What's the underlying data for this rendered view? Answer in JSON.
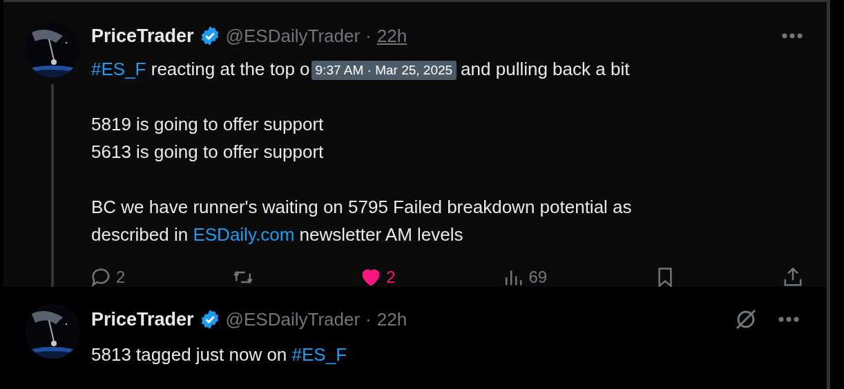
{
  "tweets": [
    {
      "author": "PriceTrader",
      "verified": true,
      "handle": "@ESDailyTrader",
      "separator": "·",
      "time": "22h",
      "time_hovered": true,
      "expanded": true,
      "paragraphs": [
        [
          [
            {
              "kind": "link",
              "text": "#ES_F"
            },
            {
              "kind": "text",
              "text": " reacting at the top o"
            },
            {
              "kind": "tooltip",
              "text": "9:37 AM · Mar 25, 2025"
            },
            {
              "kind": "text",
              "text": "and pulling back a bit"
            }
          ]
        ],
        [
          [
            {
              "kind": "text",
              "text": "5819 is going to offer support"
            }
          ],
          [
            {
              "kind": "text",
              "text": "5613 is going to offer support"
            }
          ]
        ],
        [
          [
            {
              "kind": "text",
              "text": "BC we have runner's waiting on 5795 Failed breakdown potential as"
            }
          ],
          [
            {
              "kind": "text",
              "text": "described in "
            },
            {
              "kind": "link",
              "text": "ESDaily.com"
            },
            {
              "kind": "text",
              "text": " newsletter AM levels"
            }
          ]
        ]
      ],
      "actions": [
        {
          "kind": "reply",
          "count": "2",
          "active": false
        },
        {
          "kind": "repost",
          "active": false
        },
        {
          "kind": "like",
          "count": "2",
          "active": true
        },
        {
          "kind": "views",
          "count": "69",
          "active": false
        },
        {
          "kind": "bookmark",
          "active": false
        },
        {
          "kind": "share",
          "active": false
        }
      ]
    },
    {
      "author": "PriceTrader",
      "verified": true,
      "handle": "@ESDailyTrader",
      "separator": "·",
      "time": "22h",
      "time_hovered": false,
      "expanded": false,
      "paragraphs": [
        [
          [
            {
              "kind": "text",
              "text": "5813 tagged just now on "
            },
            {
              "kind": "link",
              "text": "#ES_F"
            }
          ]
        ]
      ]
    }
  ]
}
